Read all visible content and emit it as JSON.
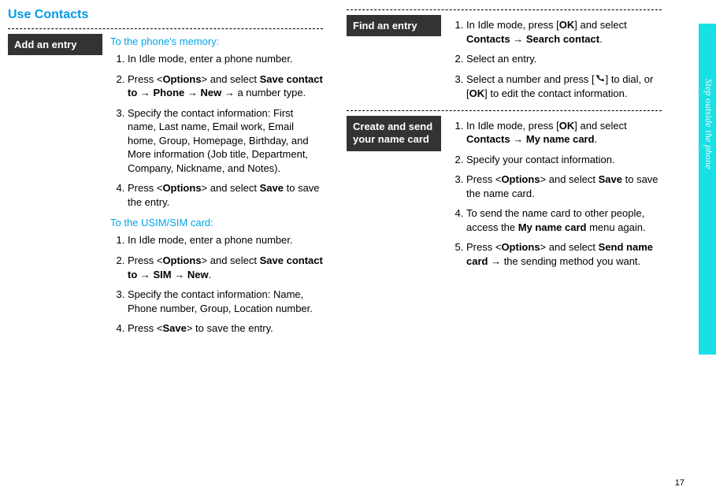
{
  "title": "Use Contacts",
  "sidebar_label": "Step outside the phone",
  "page_number": "17",
  "sections": {
    "add_entry": {
      "label": "Add an entry",
      "memory": {
        "heading": "To the phone's memory:",
        "steps": [
          "In Idle mode, enter a phone number.",
          "Press <Options> and select Save contact to → Phone → New → a number type.",
          "Specify the contact information: First name, Last name, Email work, Email home, Group, Homepage, Birthday, and More information (Job title, Department, Company, Nickname, and Notes).",
          "Press <Options> and select Save to save the entry."
        ]
      },
      "sim": {
        "heading": "To the USIM/SIM card:",
        "steps": [
          "In Idle mode, enter a phone number.",
          "Press <Options> and select Save contact to → SIM → New.",
          "Specify the contact information: Name, Phone number, Group, Location number.",
          "Press <Save> to save the entry."
        ]
      }
    },
    "find_entry": {
      "label": "Find an entry",
      "steps": [
        "In Idle mode, press [OK] and select Contacts → Search contact.",
        "Select an entry.",
        "Select a number and press [ ] to dial, or [OK] to edit the contact information."
      ]
    },
    "name_card": {
      "label": "Create and send your name card",
      "steps": [
        "In Idle mode, press [OK] and select Contacts → My name card.",
        "Specify your contact information.",
        "Press <Options> and select Save to save the name card.",
        "To send the name card to other people, access the My name card menu again.",
        "Press <Options> and select Send name card → the sending method you want."
      ]
    }
  }
}
